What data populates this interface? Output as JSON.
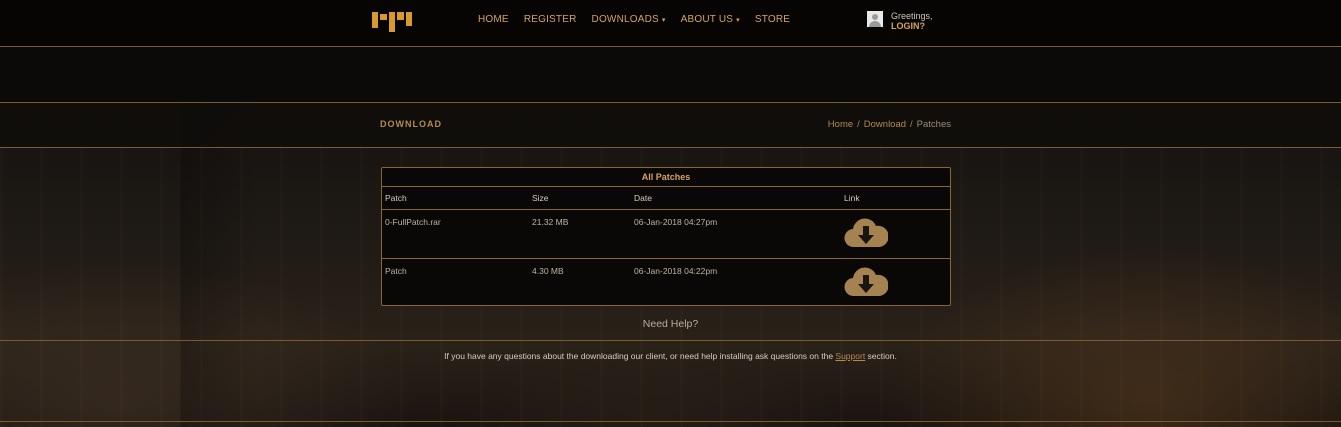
{
  "nav": {
    "items": [
      {
        "label": "HOME",
        "dropdown": false
      },
      {
        "label": "REGISTER",
        "dropdown": false
      },
      {
        "label": "DOWNLOADS",
        "dropdown": true
      },
      {
        "label": "ABOUT US",
        "dropdown": true
      },
      {
        "label": "STORE",
        "dropdown": false
      }
    ],
    "dropdown_caret": "▾"
  },
  "user": {
    "greeting": "Greetings,",
    "login_label": "LOGIN?",
    "avatar_icon": "user-avatar-icon"
  },
  "header": {
    "title": "DOWNLOAD",
    "breadcrumbs": [
      "Home",
      "Download",
      "Patches"
    ],
    "separator": "/"
  },
  "table": {
    "title": "All Patches",
    "columns": [
      "Patch",
      "Size",
      "Date",
      "Link"
    ],
    "rows": [
      {
        "patch": "0-FullPatch.rar",
        "size": "21.32 MB",
        "date": "06-Jan-2018 04:27pm",
        "link_icon": "cloud-download-icon"
      },
      {
        "patch": "Patch",
        "size": "4.30 MB",
        "date": "06-Jan-2018 04:22pm",
        "link_icon": "cloud-download-icon"
      }
    ]
  },
  "help": {
    "title": "Need Help?",
    "text_before": "If you have any questions about the downloading our client, or need help installing ask questions on the ",
    "link": "Support",
    "text_after": " section."
  },
  "colors": {
    "accent": "#d6a45c",
    "border": "#8a6633",
    "logo": "#d79a2b",
    "icon": "#a58350"
  }
}
